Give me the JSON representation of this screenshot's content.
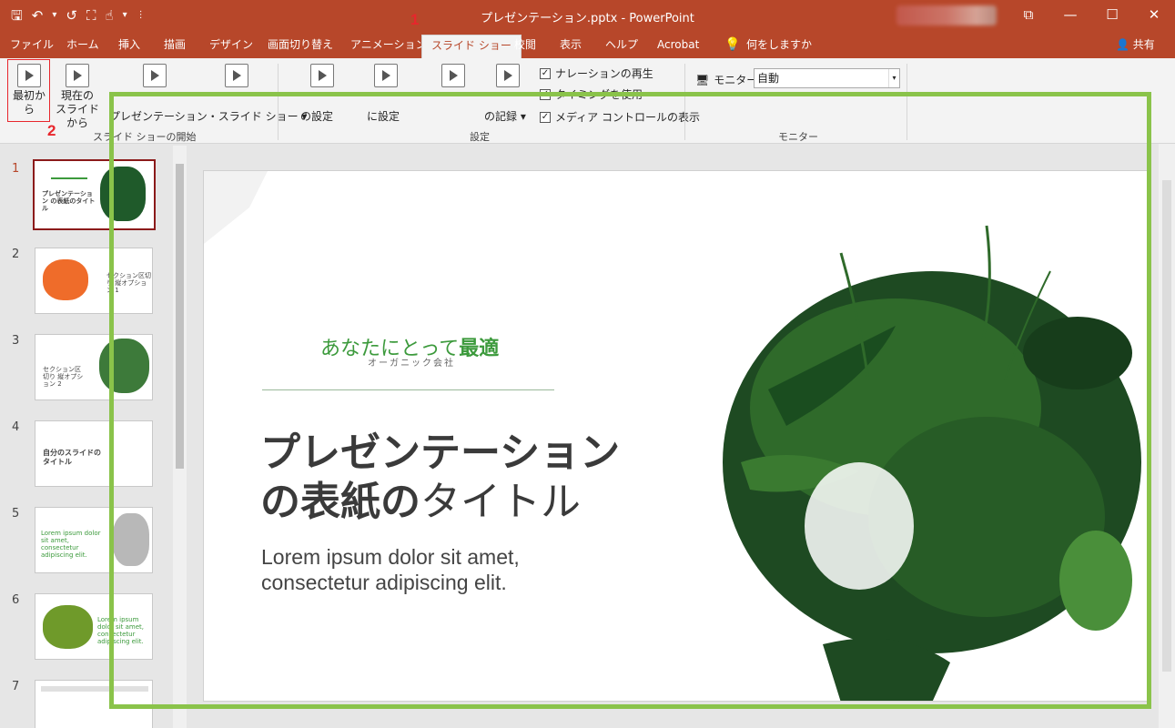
{
  "window": {
    "title": "プレゼンテーション.pptx  -  PowerPoint",
    "controls": [
      "⧉",
      "—",
      "☐",
      "✕"
    ]
  },
  "qat": [
    "🖫",
    "↶",
    "▾",
    "↺",
    "⛶",
    "☝",
    "▾",
    "⋮"
  ],
  "tabs": [
    {
      "label": "ファイル"
    },
    {
      "label": "ホーム"
    },
    {
      "label": "挿入"
    },
    {
      "label": "描画"
    },
    {
      "label": "デザイン"
    },
    {
      "label": "画面切り替え"
    },
    {
      "label": "アニメーション"
    },
    {
      "label": "スライド ショー"
    },
    {
      "label": "校閲"
    },
    {
      "label": "表示"
    },
    {
      "label": "ヘルプ"
    },
    {
      "label": "Acrobat"
    },
    {
      "label": "何をしますか"
    }
  ],
  "share_label": "共有",
  "annotations": {
    "one": "1",
    "two": "2"
  },
  "ribbon": {
    "from_start": "最初から",
    "from_current_line1": "現在の",
    "from_current_line2": "スライドから",
    "online_present": "プレゼンテーション・スライド ショー ▾",
    "group_start": "スライド ショーの開始",
    "setup_a": "の設定",
    "setup_b": "に設定",
    "record": "の記録 ▾",
    "group_setup": "設定",
    "chk_narration": "ナレーションの再生",
    "chk_timing": "タイミングを使用",
    "chk_media": "メディア コントロールの表示",
    "monitor_label": "モニター:",
    "monitor_value": "自動",
    "group_monitor": "モニター"
  },
  "thumbnails": [
    {
      "num": "1",
      "text": "プレゼンテーション の表紙のタイトル"
    },
    {
      "num": "2",
      "text": "セクション区切り 縦オプション 1"
    },
    {
      "num": "3",
      "text": "セクション区切り 縦オプション 2"
    },
    {
      "num": "4",
      "text": "自分のスライドの タイトル"
    },
    {
      "num": "5",
      "text": "Lorem ipsum dolor sit amet, consectetur adipiscing elit."
    },
    {
      "num": "6",
      "text": "Lorem ipsum dolor sit amet, consectetur adipiscing elit."
    },
    {
      "num": "7",
      "text": ""
    }
  ],
  "slide": {
    "brand_normal": "あなたにとって",
    "brand_bold": "最適",
    "brand_sub": "オーガニック会社",
    "title_bold": "プレゼンテーション",
    "title_line2_bold": "の表紙の",
    "title_line2_normal": "タイトル",
    "subtitle_line1": "Lorem ipsum dolor sit amet,",
    "subtitle_line2": "consectetur adipiscing elit."
  },
  "colors": {
    "accent": "#b7472a",
    "highlight": "#8ac34a",
    "annotation": "#e8262c",
    "brand_green": "#3c9a3c"
  }
}
